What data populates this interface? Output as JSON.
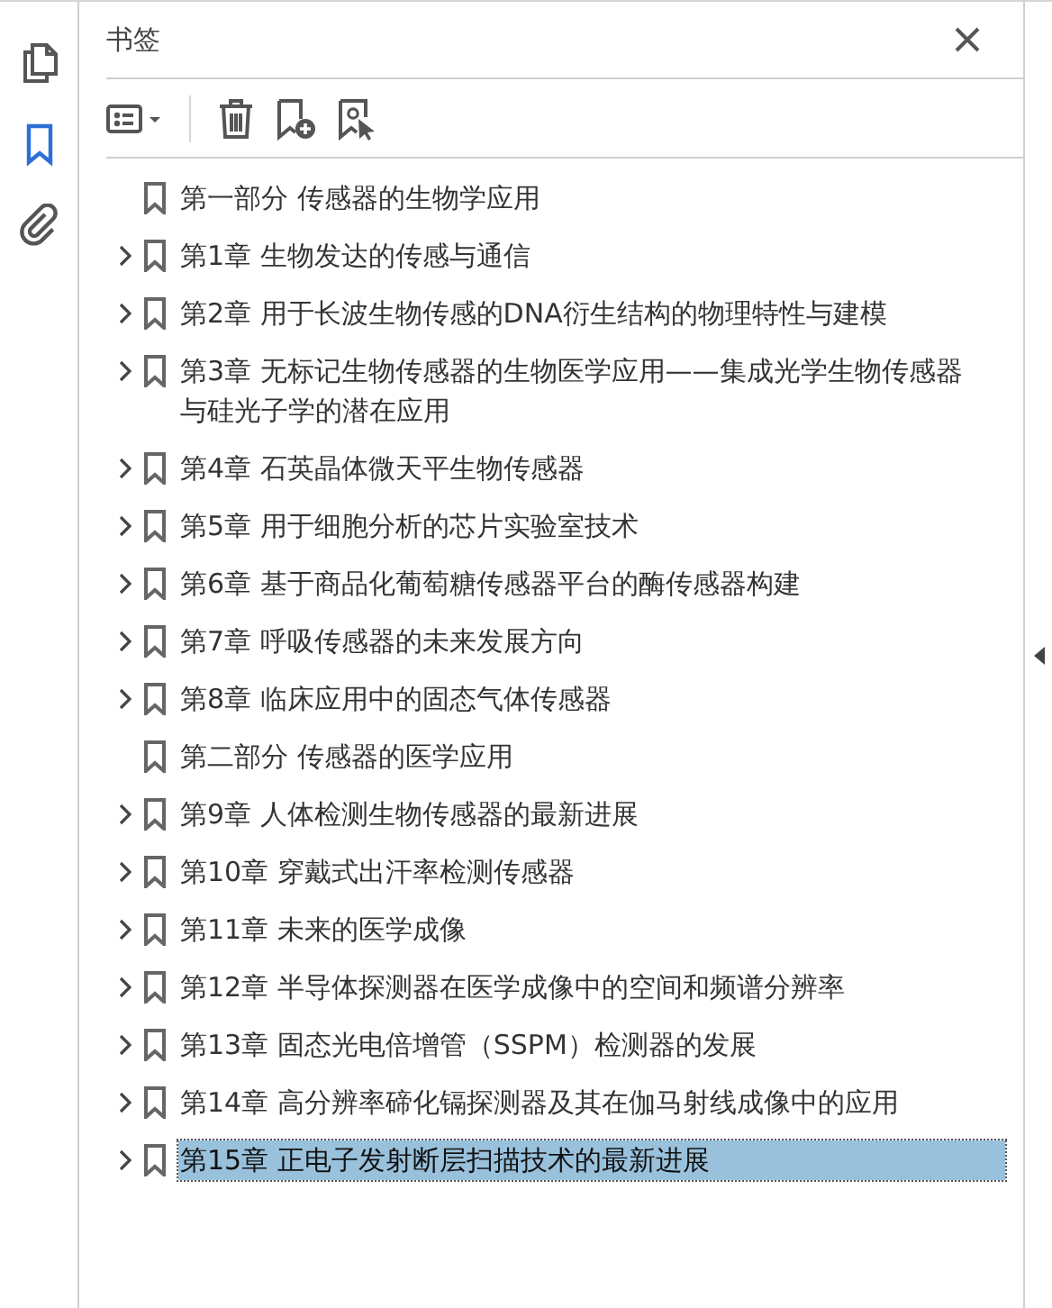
{
  "rail": [
    {
      "kind": "pages",
      "selected": false
    },
    {
      "kind": "bookmark",
      "selected": true
    },
    {
      "kind": "attachment",
      "selected": false
    }
  ],
  "panel": {
    "title": "书签"
  },
  "bookmarks": [
    {
      "label": "第一部分 传感器的生物学应用",
      "expandable": false,
      "selected": false
    },
    {
      "label": "第1章 生物发达的传感与通信",
      "expandable": true,
      "selected": false
    },
    {
      "label": "第2章 用于长波生物传感的DNA衍生结构的物理特性与建模",
      "expandable": true,
      "selected": false
    },
    {
      "label": "第3章 无标记生物传感器的生物医学应用——集成光学生物传感器与硅光子学的潜在应用",
      "expandable": true,
      "selected": false
    },
    {
      "label": "第4章 石英晶体微天平生物传感器",
      "expandable": true,
      "selected": false
    },
    {
      "label": "第5章 用于细胞分析的芯片实验室技术",
      "expandable": true,
      "selected": false
    },
    {
      "label": "第6章 基于商品化葡萄糖传感器平台的酶传感器构建",
      "expandable": true,
      "selected": false
    },
    {
      "label": "第7章 呼吸传感器的未来发展方向",
      "expandable": true,
      "selected": false
    },
    {
      "label": "第8章 临床应用中的固态气体传感器",
      "expandable": true,
      "selected": false
    },
    {
      "label": "第二部分 传感器的医学应用",
      "expandable": false,
      "selected": false
    },
    {
      "label": "第9章 人体检测生物传感器的最新进展",
      "expandable": true,
      "selected": false
    },
    {
      "label": "第10章 穿戴式出汗率检测传感器",
      "expandable": true,
      "selected": false
    },
    {
      "label": "第11章 未来的医学成像",
      "expandable": true,
      "selected": false
    },
    {
      "label": "第12章 半导体探测器在医学成像中的空间和频谱分辨率",
      "expandable": true,
      "selected": false
    },
    {
      "label": "第13章 固态光电倍增管（SSPM）检测器的发展",
      "expandable": true,
      "selected": false
    },
    {
      "label": "第14章 高分辨率碲化镉探测器及其在伽马射线成像中的应用",
      "expandable": true,
      "selected": false
    },
    {
      "label": "第15章 正电子发射断层扫描技术的最新进展",
      "expandable": true,
      "selected": true
    }
  ]
}
